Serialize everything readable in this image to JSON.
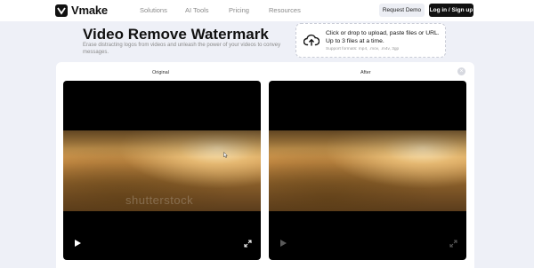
{
  "header": {
    "logo_text": "Vmake",
    "nav": [
      "Solutions",
      "AI Tools",
      "Pricing",
      "Resources"
    ],
    "request_demo": "Request Demo",
    "login": "Log in / Sign up"
  },
  "hero": {
    "title": "Video Remove Watermark",
    "description": "Erase distracting logos from videos and unleash the power of your videos to convey messages."
  },
  "upload": {
    "main": "Click or drop to upload, paste files or URL. Up to 3 files at a time.",
    "sub": "Support formats: mp4, .mov, .m4v, 3gp"
  },
  "compare": {
    "original_label": "Original",
    "after_label": "After",
    "watermark_text": "shutterstock"
  },
  "icons": {
    "logo": "vmake-logo-icon",
    "upload": "cloud-upload-icon",
    "close": "close-icon",
    "play": "play-icon",
    "expand": "expand-icon"
  }
}
